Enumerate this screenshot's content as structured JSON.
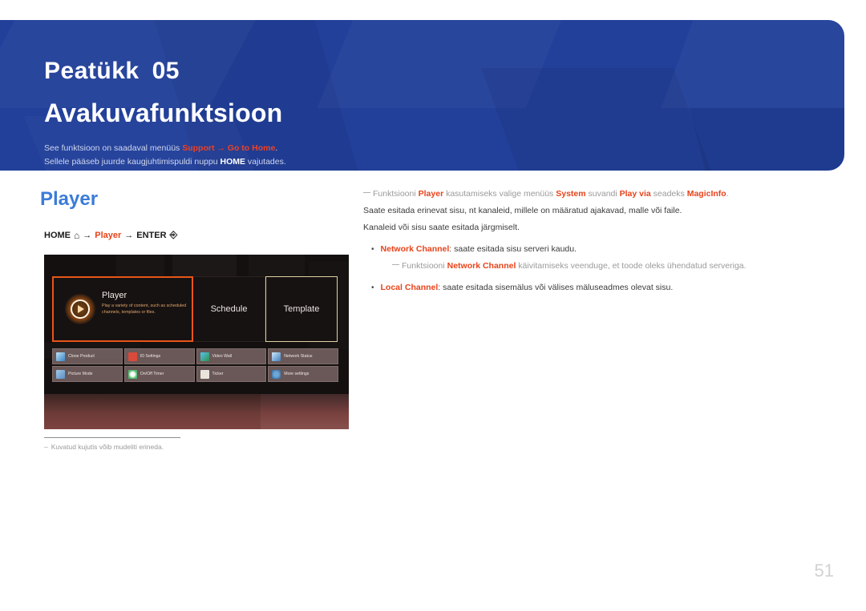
{
  "banner": {
    "chapter_word": "Peatükk",
    "chapter_number": "05",
    "title": "Avakuvafunktsioon",
    "note_line1_pre": "See funktsioon on saadaval menüüs ",
    "note_line1_hl1": "Support",
    "note_line1_arrow": "→",
    "note_line1_hl2": "Go to Home",
    "note_line1_post": ".",
    "note_line2_pre": "Sellele pääseb juurde kaugjuhtimispuldi nuppu ",
    "note_line2_bold": "HOME",
    "note_line2_post": " vajutades."
  },
  "section": {
    "title": "Player",
    "nav_home": "HOME",
    "nav_home_icon": "home-icon",
    "nav_arrow1": "→",
    "nav_player": "Player",
    "nav_arrow2": "→",
    "nav_enter": "ENTER",
    "nav_enter_icon": "enter-key-icon"
  },
  "tv_screenshot": {
    "tiles": [
      {
        "label": "Player",
        "description": "Play a variety of content, such as scheduled channels, templates or files.",
        "selected": true,
        "icon": "play-circle-icon"
      },
      {
        "label": "Schedule",
        "description": "",
        "selected": false,
        "icon": ""
      },
      {
        "label": "Template",
        "description": "",
        "selected": false,
        "icon": ""
      }
    ],
    "grid": [
      [
        {
          "label": "Clone Product",
          "icon": "clone-product-icon"
        },
        {
          "label": "ID Settings",
          "icon": "id-settings-icon"
        },
        {
          "label": "Video Wall",
          "icon": "video-wall-icon"
        },
        {
          "label": "Network Status",
          "icon": "network-status-icon"
        }
      ],
      [
        {
          "label": "Picture Mode",
          "icon": "picture-mode-icon"
        },
        {
          "label": "On/Off Timer",
          "icon": "on-off-timer-icon"
        },
        {
          "label": "Ticker",
          "icon": "ticker-icon"
        },
        {
          "label": "More settings",
          "icon": "more-settings-icon"
        }
      ]
    ]
  },
  "caption": {
    "dash": "–",
    "text": "Kuvatud kujutis võib mudeliti erineda."
  },
  "right_column": {
    "note1_pre": "Funktsiooni ",
    "note1_b1": "Player",
    "note1_mid1": " kasutamiseks valige menüüs ",
    "note1_b2": "System",
    "note1_mid2": " suvandi ",
    "note1_b3": "Play via",
    "note1_mid3": " seadeks ",
    "note1_b4": "MagicInfo",
    "note1_post": ".",
    "para1": "Saate esitada erinevat sisu, nt kanaleid, millele on määratud ajakavad, malle või faile.",
    "para2": "Kanaleid või sisu saate esitada järgmiselt.",
    "bullet1_label": "Network Channel",
    "bullet1_text": ": saate esitada sisu serveri kaudu.",
    "subnote_pre": "Funktsiooni ",
    "subnote_b": "Network Channel",
    "subnote_post": " käivitamiseks veenduge, et toode oleks ühendatud serveriga.",
    "bullet2_label": "Local Channel",
    "bullet2_text": ": saate esitada sisemälus või välises mäluseadmes olevat sisu."
  },
  "page_number": "51",
  "colors": {
    "banner_blue": "#22409A",
    "accent_red": "#e8431b",
    "section_blue": "#3b7cd8",
    "tile_orange": "#e8551a"
  }
}
